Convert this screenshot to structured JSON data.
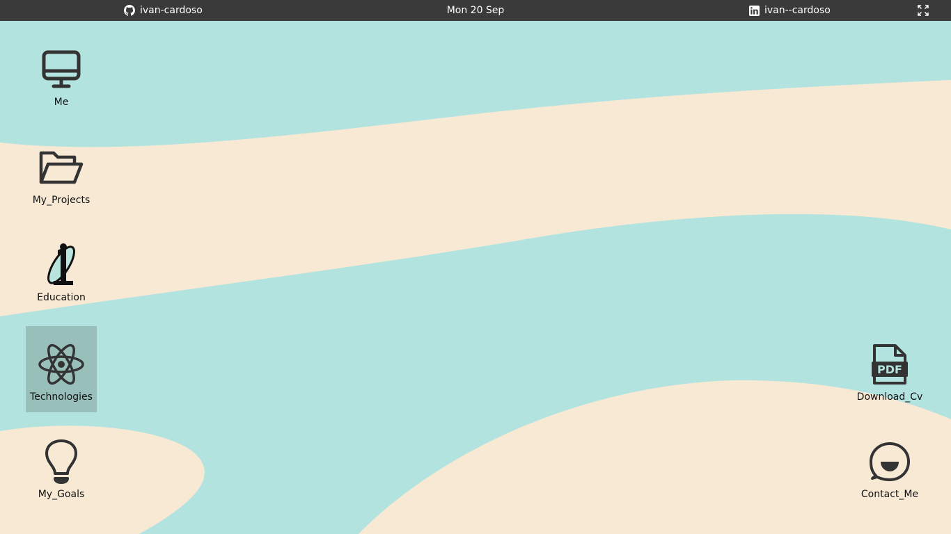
{
  "topbar": {
    "github_user": "ivan-cardoso",
    "date": "Mon 20 Sep",
    "linkedin_user": "ivan--cardoso",
    "fullscreen_icon": "fullscreen-icon"
  },
  "desktop": {
    "colors": {
      "teal": "#b3e3df",
      "cream": "#f8e9d5",
      "icon_stroke": "#333333",
      "topbar": "#3a3a3a"
    },
    "icons": [
      {
        "label": "Me",
        "icon": "monitor-icon",
        "selected": false
      },
      {
        "label": "My_Projects",
        "icon": "folder-open-icon",
        "selected": false
      },
      {
        "label": "Education",
        "icon": "education-logo-icon",
        "selected": false
      },
      {
        "label": "Technologies",
        "icon": "react-atom-icon",
        "selected": true
      },
      {
        "label": "My_Goals",
        "icon": "lightbulb-icon",
        "selected": false
      },
      {
        "label": "Download_Cv",
        "icon": "pdf-file-icon",
        "selected": false,
        "icon_text": "PDF"
      },
      {
        "label": "Contact_Me",
        "icon": "chat-bubble-icon",
        "selected": false
      }
    ]
  }
}
